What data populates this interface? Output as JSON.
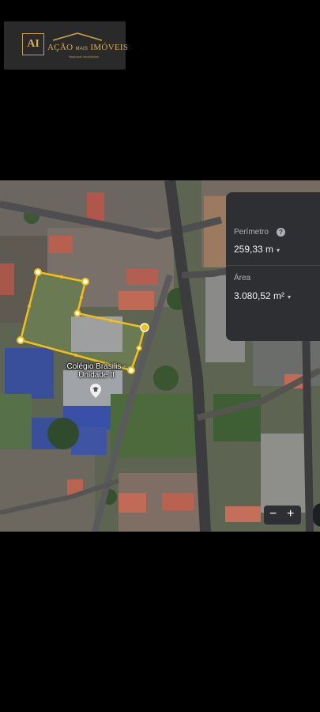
{
  "logo": {
    "monogram": "AI",
    "brand_main": "AÇÃO",
    "brand_small": "MAIS",
    "brand_end": "IMÓVEIS",
    "tagline": "Negócios Imobiliários"
  },
  "map": {
    "poi_label": "Colégio Brasilis - Unidade II",
    "poi_icon": "school-pin-icon"
  },
  "measure": {
    "perimeter_label": "Perímetro",
    "perimeter_value": "259,33 m",
    "area_label": "Área",
    "area_value": "3.080,52 m²",
    "help_symbol": "?",
    "caret_symbol": "▾"
  },
  "zoom": {
    "minus": "−",
    "plus": "+"
  },
  "colors": {
    "outline": "#f2c014",
    "panel": "#2e2f33",
    "background": "#000000",
    "logo_gold": "#d6b05a"
  }
}
